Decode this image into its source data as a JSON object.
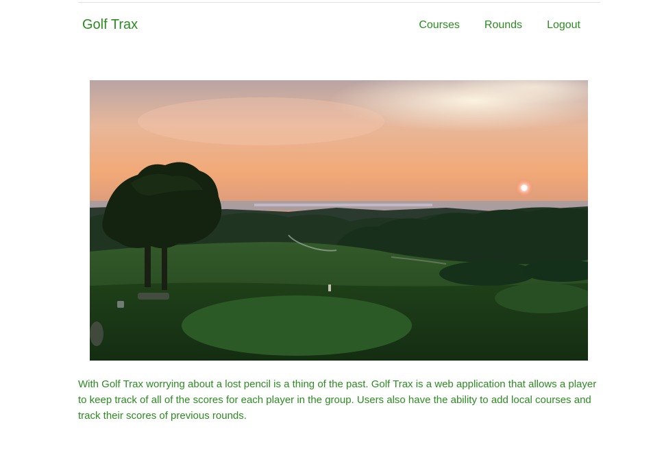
{
  "header": {
    "brand": "Golf Trax",
    "nav": [
      {
        "label": "Courses"
      },
      {
        "label": "Rounds"
      },
      {
        "label": "Logout"
      }
    ]
  },
  "main": {
    "description": "With Golf Trax worrying about a lost pencil is a thing of the past. Golf Trax is a web application that allows a player to keep track of all of the scores for each player in the group. Users also have the ability to add local courses and track their scores of previous rounds."
  },
  "colors": {
    "accent": "#2a8c1f",
    "divider": "#e2e2e2"
  }
}
